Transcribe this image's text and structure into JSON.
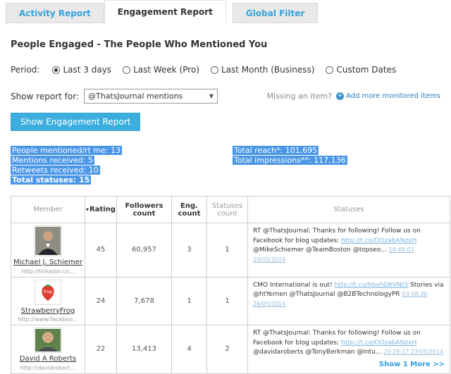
{
  "tabs": [
    {
      "label": "Activity Report",
      "active": false
    },
    {
      "label": "Engagement Report",
      "active": true
    },
    {
      "label": "Global Filter",
      "active": false
    }
  ],
  "page_title": "People Engaged - The People Who Mentioned You",
  "period": {
    "label": "Period:",
    "options": [
      {
        "label": "Last 3 days",
        "selected": true
      },
      {
        "label": "Last Week (Pro)",
        "selected": false
      },
      {
        "label": "Last Month (Business)",
        "selected": false
      },
      {
        "label": "Custom Dates",
        "selected": false
      }
    ]
  },
  "report_selector": {
    "label": "Show report for:",
    "selected_value": "@ThatsJournal mentions"
  },
  "missing_item": {
    "text": "Missing an item?",
    "link": "Add more monitored items"
  },
  "show_report_button": "Show Engagement Report",
  "stats": {
    "left": [
      {
        "text": "People mentioned/rt me: 13"
      },
      {
        "text": "Mentions received: 5"
      },
      {
        "text": "Retweets received: 10"
      },
      {
        "text": "Total statuses: 15"
      }
    ],
    "right": [
      {
        "text": "Total reach*: 101,695"
      },
      {
        "text": "Total impressions**: 117,136"
      }
    ]
  },
  "icons": {
    "sort_desc": "▾",
    "select_chevron": "▼",
    "add_plus": "+"
  },
  "table": {
    "headers": [
      "Member",
      "Rating",
      "Followers count",
      "Eng. count",
      "Statuses count",
      "Statuses"
    ],
    "rows": [
      {
        "member_name": "Michael J. Schiemer",
        "member_url": "http://linkedin.co...",
        "rating": "45",
        "followers": "60,957",
        "eng_count": "3",
        "statuses_count": "1",
        "status": {
          "pre": "RT @ThatsJournal: Thanks for following! Follow us on Facebook for blog updates: ",
          "link": "http://t.co/OOzabANzxH",
          "mid": " @MikeSchiemer @TeamBoston @topseo... ",
          "time": "19:48:03 20/05/2014"
        }
      },
      {
        "member_name": "StrawberryFrog",
        "member_url": "http://www.faceboo...",
        "avatar_text": "frog",
        "rating": "24",
        "followers": "7,678",
        "eng_count": "1",
        "statuses_count": "1",
        "status": {
          "pre": "CMO International is out! ",
          "link": "http://t.co/hbxhD6VNt5",
          "mid": " Stories via @htYernen @ThatsJournal @B2BTechnologyPR ",
          "time": "03:58:30 26/05/2014"
        }
      },
      {
        "member_name": "David A Roberts",
        "member_url": "http://davidrobert...",
        "rating": "22",
        "followers": "13,413",
        "eng_count": "4",
        "statuses_count": "2",
        "status": {
          "pre": "RT @ThatsJournal: Thanks for following! Follow us on Facebook for blog updates: ",
          "link": "http://t.co/OOzabANzxH",
          "mid": " @davidaroberts @TonyBerkman @Intu... ",
          "time": "20:28:17 23/05/2014"
        }
      }
    ],
    "show_more": "Show 1 More >>"
  }
}
